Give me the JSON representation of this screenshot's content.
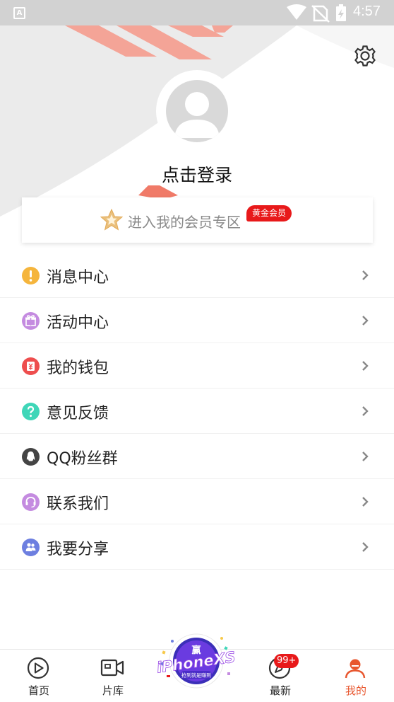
{
  "status_bar": {
    "time": "4:57",
    "notification_icon": "A"
  },
  "header": {
    "login_text": "点击登录",
    "settings_icon": "gear-icon",
    "avatar_icon": "person-icon",
    "stripe_color": "#f08a7a"
  },
  "vip": {
    "text": "进入我的会员专区",
    "badge": "黄金会员",
    "star_color": "#e9b45c",
    "badge_color": "#e8191a"
  },
  "menu": {
    "items": [
      {
        "label": "消息中心",
        "icon": "exclamation-icon",
        "color": "#f5b53c"
      },
      {
        "label": "活动中心",
        "icon": "gift-icon",
        "color": "#c48be0"
      },
      {
        "label": "我的钱包",
        "icon": "wallet-icon",
        "color": "#ee4e4e"
      },
      {
        "label": "意见反馈",
        "icon": "question-icon",
        "color": "#3fd6b8"
      },
      {
        "label": "QQ粉丝群",
        "icon": "qq-icon",
        "color": "#444444"
      },
      {
        "label": "联系我们",
        "icon": "headset-icon",
        "color": "#c48be0"
      },
      {
        "label": "我要分享",
        "icon": "share-people-icon",
        "color": "#6d7fe0"
      }
    ]
  },
  "nav": {
    "items": [
      {
        "label": "首页",
        "icon": "play-circle-icon"
      },
      {
        "label": "片库",
        "icon": "video-camera-icon"
      },
      {
        "label": "最新",
        "icon": "compass-icon",
        "badge": "99+"
      },
      {
        "label": "我的",
        "icon": "profile-icon",
        "active": true
      }
    ],
    "active_color": "#e8562e",
    "promo": {
      "line1": "赢",
      "line2": "iPhoneXS",
      "line3": "抢到就是赚到"
    }
  }
}
